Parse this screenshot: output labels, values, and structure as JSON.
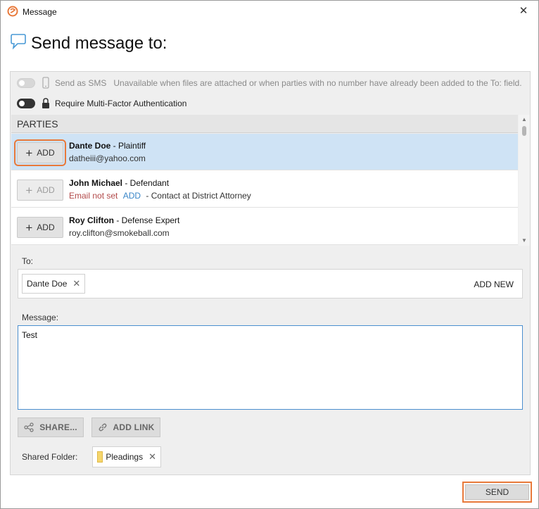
{
  "window": {
    "title": "Message",
    "close_glyph": "✕"
  },
  "heading": {
    "title": "Send message to:"
  },
  "options": {
    "sms_label": "Send as SMS",
    "sms_note": "Unavailable when files are attached or when parties with no number have already been added to the To: field.",
    "mfa_label": "Require Multi-Factor Authentication"
  },
  "parties": {
    "header": "PARTIES",
    "add_label": "ADD",
    "plus_glyph": "+",
    "items": [
      {
        "name": "Dante Doe",
        "role": " - Plaintiff",
        "email": "datheiii@yahoo.com",
        "selected": true
      },
      {
        "name": "John Michael",
        "role": " - Defendant",
        "email_missing": "Email not set",
        "add_link": "ADD",
        "extra": " - Contact at District Attorney",
        "disabled": true
      },
      {
        "name": "Roy Clifton",
        "role": " - Defense Expert",
        "email": "roy.clifton@smokeball.com"
      }
    ]
  },
  "to": {
    "label": "To:",
    "recipients": [
      "Dante Doe"
    ],
    "remove_glyph": "✕",
    "add_new": "ADD NEW"
  },
  "message": {
    "label": "Message:",
    "value": "Test"
  },
  "actions": {
    "share": "SHARE...",
    "add_link": "ADD LINK"
  },
  "shared_folder": {
    "label": "Shared Folder:",
    "folder": "Pleadings",
    "remove_glyph": "✕"
  },
  "footer": {
    "send": "SEND"
  },
  "colors": {
    "accent": "#e8793a",
    "selected_row": "#cfe3f5",
    "panel_bg": "#efefef",
    "link": "#3a86c8",
    "warning": "#b24a4a"
  },
  "icons": [
    "app-logo-icon",
    "close-icon",
    "speech-bubble-icon",
    "phone-icon",
    "lock-icon",
    "plus-icon",
    "share-icon",
    "link-icon",
    "folder-icon"
  ]
}
